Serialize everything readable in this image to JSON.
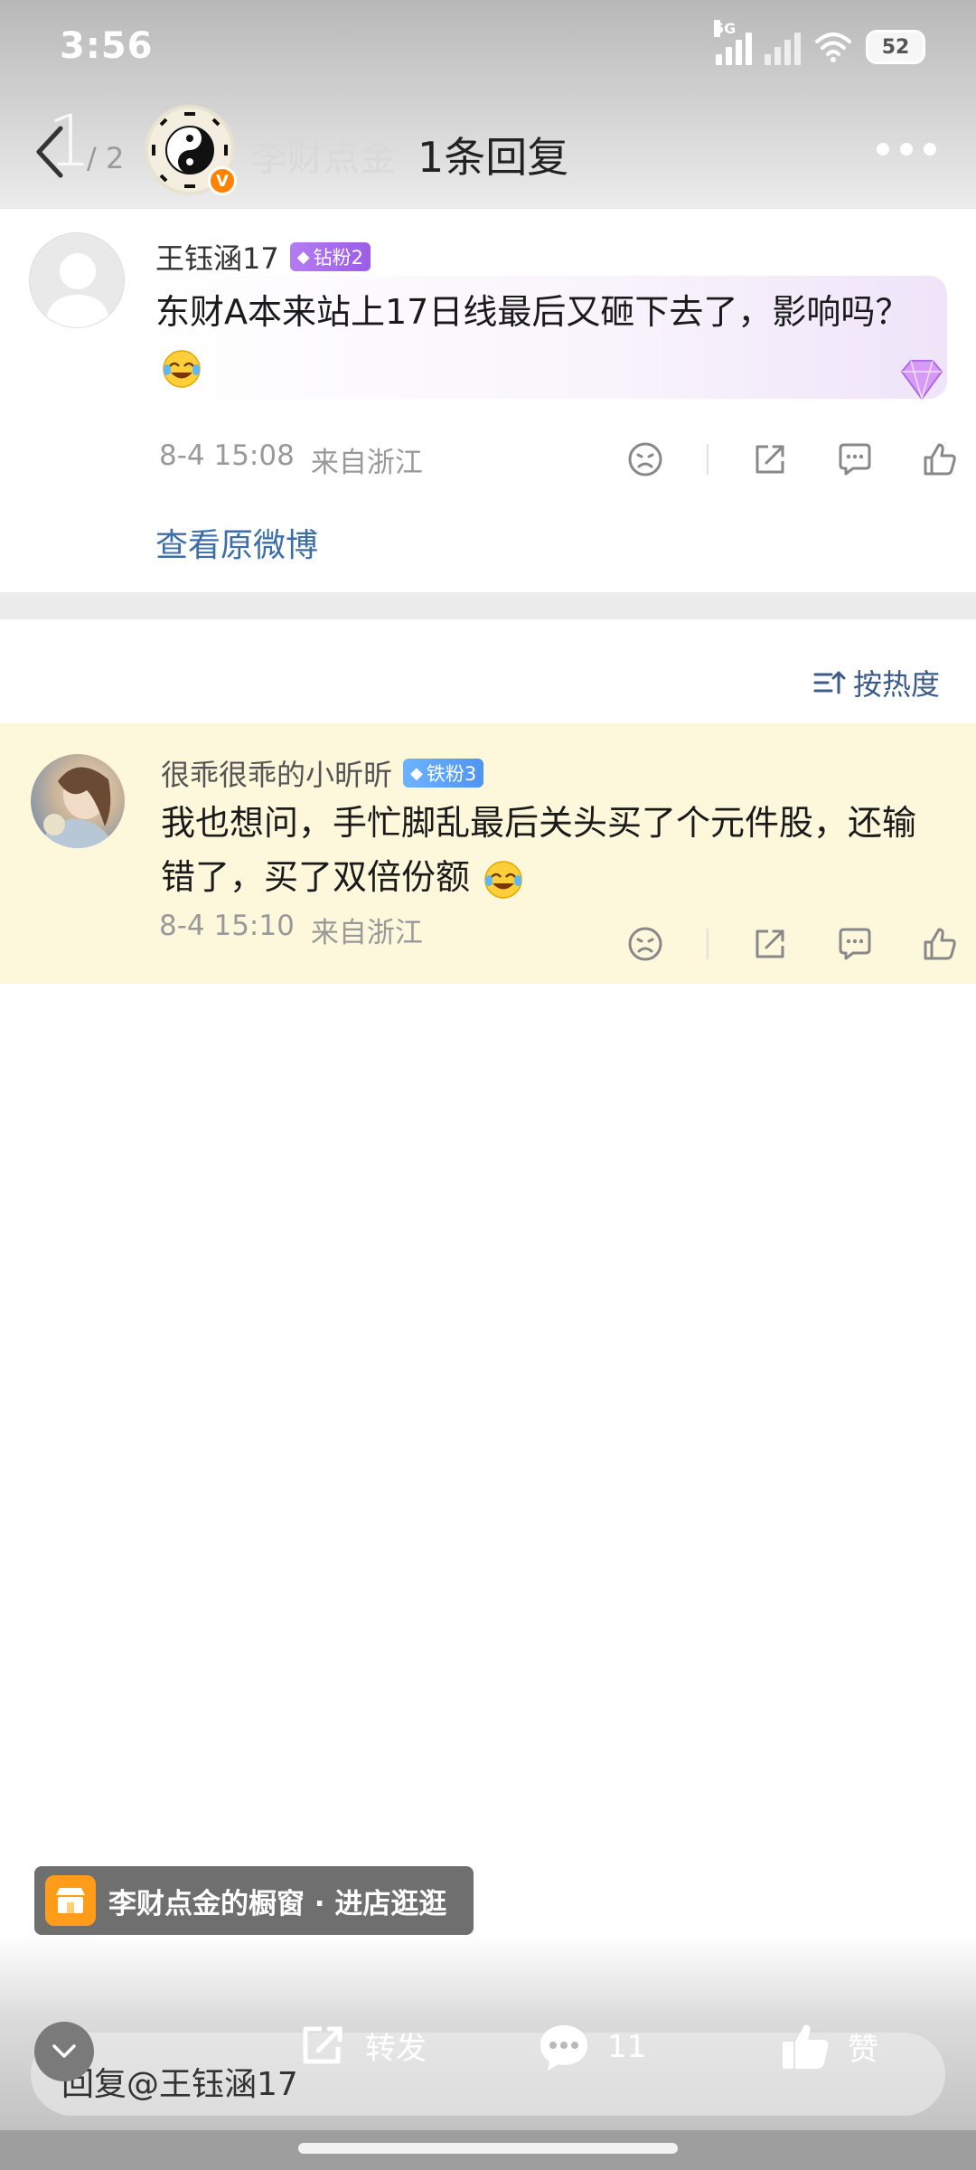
{
  "status_bar": {
    "time": "3:56",
    "network": "5G",
    "battery": "52"
  },
  "nav": {
    "page_current": "1",
    "page_total": "/ 2",
    "author": "李财点金",
    "title": "1条回复",
    "verified_mark": "V"
  },
  "main_comment": {
    "user": "王钰涵17",
    "badge": "钻粉2",
    "text": "东财A本来站上17日线最后又砸下去了，影响吗？",
    "time": "8-4 15:08",
    "location": "来自浙江",
    "view_original": "查看原微博"
  },
  "sort": {
    "label": "按热度"
  },
  "reply": {
    "user": "很乖很乖的小昕昕",
    "badge": "铁粉3",
    "text": "我也想问，手忙脚乱最后关头买了个元件股，还输错了，买了双倍份额",
    "time": "8-4 15:10",
    "location": "来自浙江"
  },
  "shop_banner": {
    "label": "李财点金的橱窗 · 进店逛逛"
  },
  "toolbar": {
    "repost": "转发",
    "comment_count": "11",
    "like": "赞"
  },
  "reply_input": {
    "text": "回复@王钰涵17"
  },
  "colors": {
    "link": "#3c6ea8",
    "highlight_bg": "#fdf8dc",
    "badge_diamond": "#9b5de5",
    "badge_iron": "#4f95f0",
    "verified": "#ff8200",
    "shop": "#ff9d1a"
  }
}
